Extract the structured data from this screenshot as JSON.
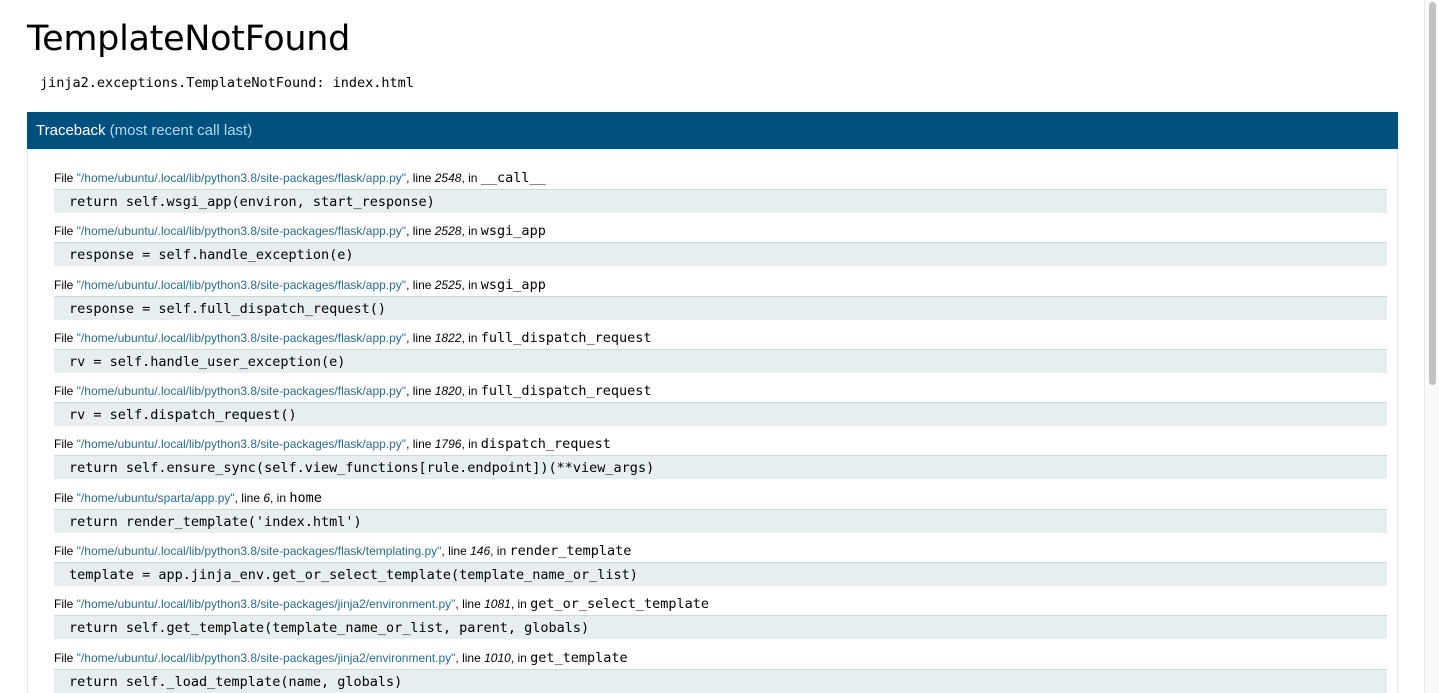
{
  "title": "TemplateNotFound",
  "error_message": "jinja2.exceptions.TemplateNotFound: index.html",
  "traceback": {
    "heading": "Traceback",
    "subheading": "(most recent call last)",
    "file_prefix": "File ",
    "line_prefix": ", line ",
    "in_prefix": ", in ",
    "frames": [
      {
        "file": "\"/home/ubuntu/.local/lib/python3.8/site-packages/flask/app.py\"",
        "line": "2548",
        "func": "__call__",
        "code": "return self.wsgi_app(environ, start_response)"
      },
      {
        "file": "\"/home/ubuntu/.local/lib/python3.8/site-packages/flask/app.py\"",
        "line": "2528",
        "func": "wsgi_app",
        "code": "response = self.handle_exception(e)"
      },
      {
        "file": "\"/home/ubuntu/.local/lib/python3.8/site-packages/flask/app.py\"",
        "line": "2525",
        "func": "wsgi_app",
        "code": "response = self.full_dispatch_request()"
      },
      {
        "file": "\"/home/ubuntu/.local/lib/python3.8/site-packages/flask/app.py\"",
        "line": "1822",
        "func": "full_dispatch_request",
        "code": "rv = self.handle_user_exception(e)"
      },
      {
        "file": "\"/home/ubuntu/.local/lib/python3.8/site-packages/flask/app.py\"",
        "line": "1820",
        "func": "full_dispatch_request",
        "code": "rv = self.dispatch_request()"
      },
      {
        "file": "\"/home/ubuntu/.local/lib/python3.8/site-packages/flask/app.py\"",
        "line": "1796",
        "func": "dispatch_request",
        "code": "return self.ensure_sync(self.view_functions[rule.endpoint])(**view_args)"
      },
      {
        "file": "\"/home/ubuntu/sparta/app.py\"",
        "line": "6",
        "func": "home",
        "code": "return render_template('index.html')"
      },
      {
        "file": "\"/home/ubuntu/.local/lib/python3.8/site-packages/flask/templating.py\"",
        "line": "146",
        "func": "render_template",
        "code": "template = app.jinja_env.get_or_select_template(template_name_or_list)"
      },
      {
        "file": "\"/home/ubuntu/.local/lib/python3.8/site-packages/jinja2/environment.py\"",
        "line": "1081",
        "func": "get_or_select_template",
        "code": "return self.get_template(template_name_or_list, parent, globals)"
      },
      {
        "file": "\"/home/ubuntu/.local/lib/python3.8/site-packages/jinja2/environment.py\"",
        "line": "1010",
        "func": "get_template",
        "code": "return self._load_template(name, globals)"
      }
    ]
  },
  "colors": {
    "header_bg": "#00507f",
    "header_sub": "#aeddf0",
    "file_link": "#2a6c8c",
    "code_bg": "#e6eef0"
  }
}
